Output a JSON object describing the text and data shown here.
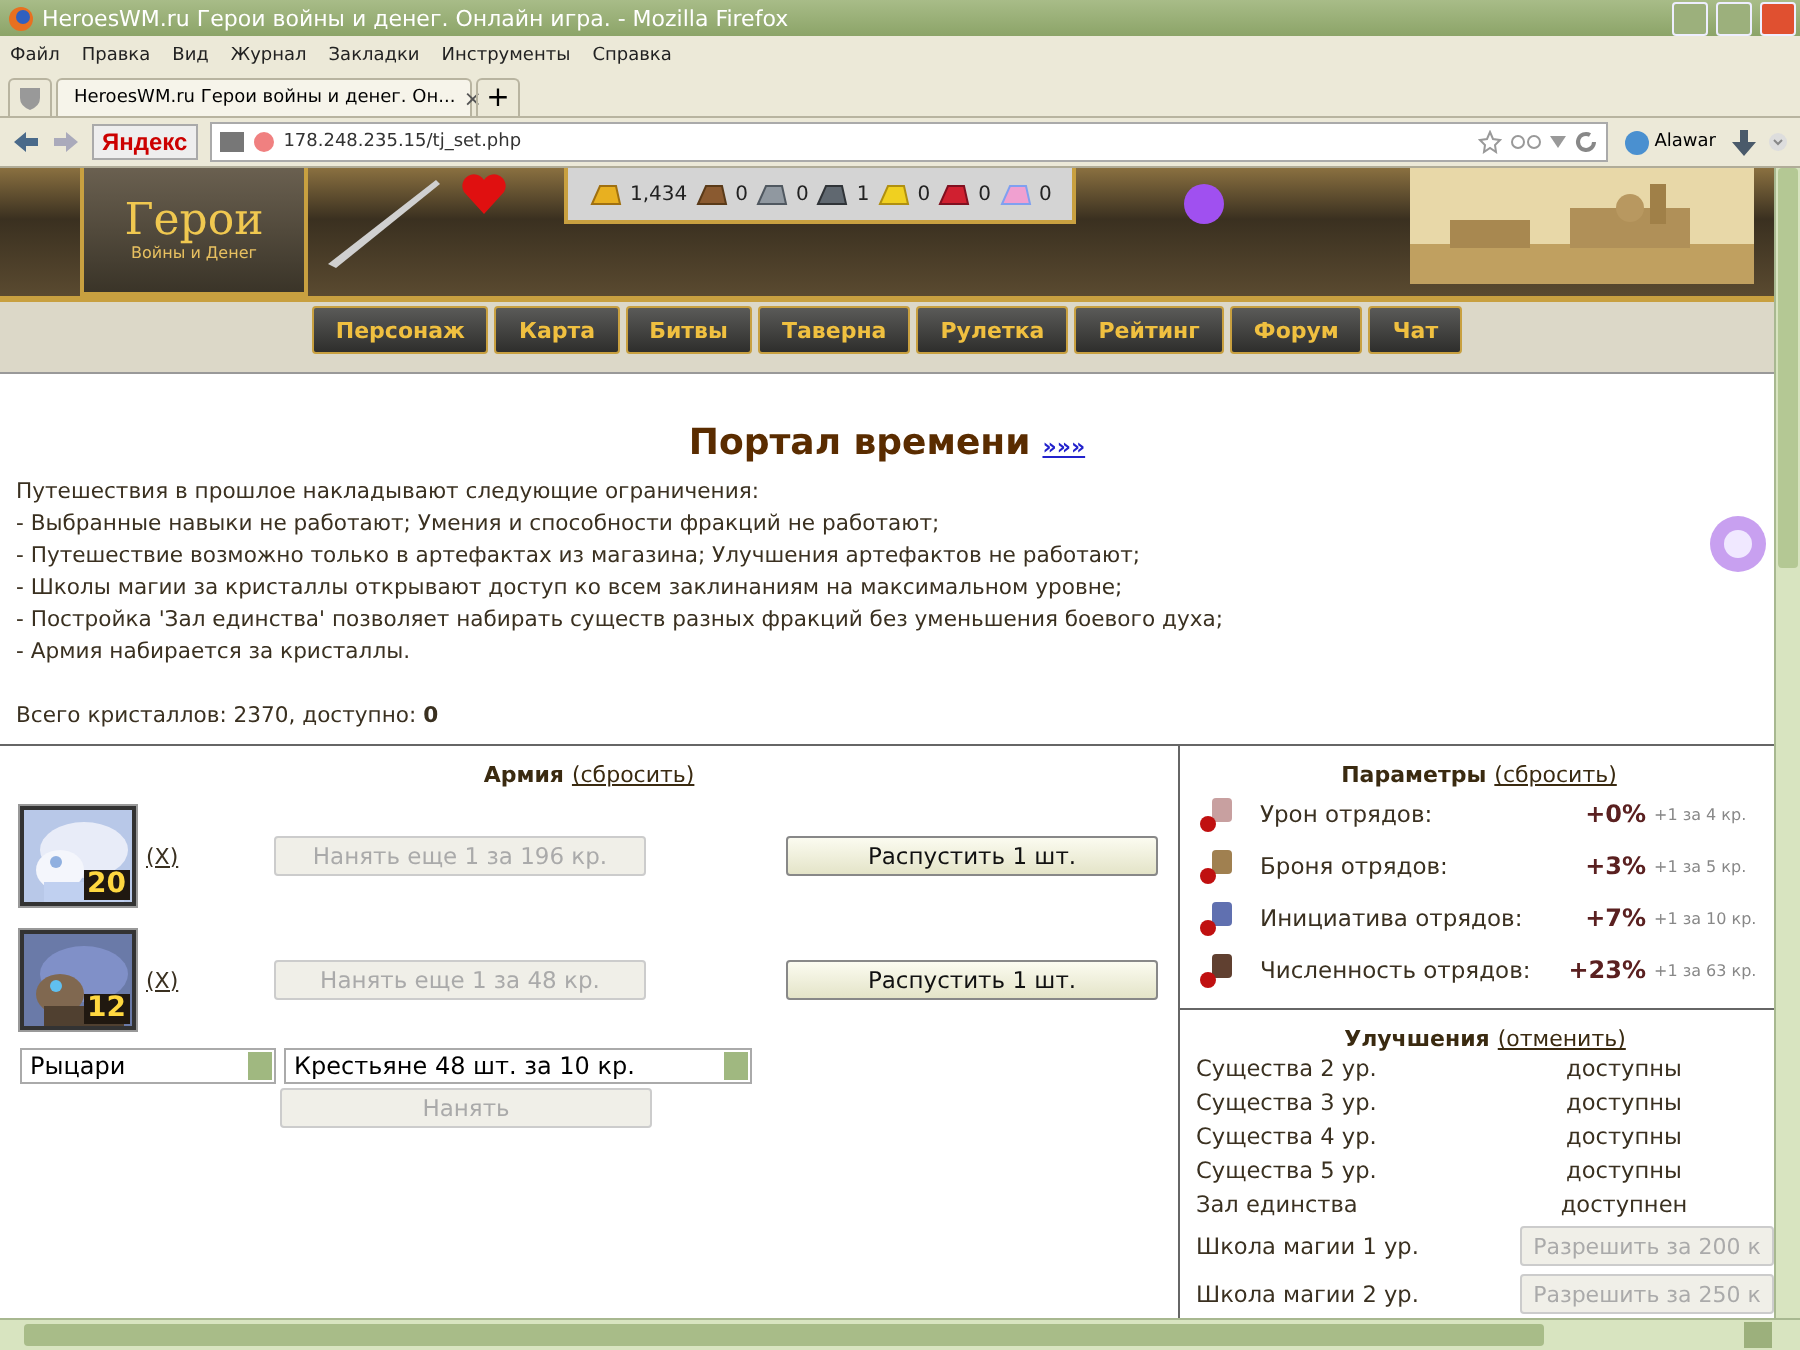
{
  "window": {
    "title": "HeroesWM.ru Герои войны и денег. Онлайн игра. - Mozilla Firefox"
  },
  "menu": [
    "Файл",
    "Правка",
    "Вид",
    "Журнал",
    "Закладки",
    "Инструменты",
    "Справка"
  ],
  "tabs": [
    {
      "label": "HeroesWM.ru Герои войны и денег. Он...",
      "close": "×",
      "selected": true
    }
  ],
  "new_tab": "+",
  "toolbar": {
    "search_brand": "Яндекс",
    "url": "178.248.235.15/tj_set.php",
    "addon": "Alawar"
  },
  "game_header": {
    "logo_title": "Герои",
    "logo_subtitle": "Войны и Денег",
    "resources": [
      {
        "amount": "1,434"
      },
      {
        "amount": "0"
      },
      {
        "amount": "0"
      },
      {
        "amount": "1"
      },
      {
        "amount": "0"
      },
      {
        "amount": "0"
      },
      {
        "amount": "0"
      }
    ],
    "nav": [
      "Персонаж",
      "Карта",
      "Битвы",
      "Таверна",
      "Рулетка",
      "Рейтинг",
      "Форум",
      "Чат"
    ]
  },
  "page": {
    "title": "Портал времени",
    "title_link": "»»»",
    "intro": [
      "Путешествия в прошлое накладывают следующие ограничения:",
      "- Выбранные навыки не работают; Умения и способности фракций не работают;",
      "- Путешествие возможно только в артефактах из магазина; Улучшения артефактов не работают;",
      "- Школы магии за кристаллы открывают доступ ко всем заклинаниям на максимальном уровне;",
      "- Постройка 'Зал единства' позволяет набирать существ разных фракций без уменьшения боевого духа;",
      "- Армия набирается за кристаллы."
    ],
    "crystals": "Всего кристаллов: 2370, доступно: **0**"
  },
  "army": {
    "title": "Армия",
    "reset": "(сбросить)",
    "units": [
      {
        "count": "20",
        "remove": "(X)",
        "hire": {
          "label": "Нанять еще 1 за 196 кр.",
          "disabled": true
        },
        "dismiss": "Распустить 1 шт."
      },
      {
        "count": "12",
        "remove": "(X)",
        "hire": {
          "label": "Нанять еще 1 за 48 кр.",
          "disabled": true
        },
        "dismiss": "Распустить 1 шт."
      }
    ],
    "faction_select": "Рыцари",
    "unit_select": "Крестьяне 48 шт. за 10 кр.",
    "hire_button": {
      "label": "Нанять",
      "disabled": true
    }
  },
  "parameters": {
    "title": "Параметры",
    "reset": "(сбросить)",
    "rows": [
      {
        "label": "Урон отрядов:",
        "value": "+0%",
        "cost": "+1 за 4 кр."
      },
      {
        "label": "Броня отрядов:",
        "value": "+3%",
        "cost": "+1 за 5 кр."
      },
      {
        "label": "Инициатива отрядов:",
        "value": "+7%",
        "cost": "+1 за 10 кр."
      },
      {
        "label": "Численность отрядов:",
        "value": "+23%",
        "cost": "+1 за 63 кр."
      }
    ]
  },
  "upgrades": {
    "title": "Улучшения",
    "cancel": "(отменить)",
    "rows": [
      {
        "kind": "status",
        "label": "Существа 2 ур.",
        "status": "доступны"
      },
      {
        "kind": "status",
        "label": "Существа 3 ур.",
        "status": "доступны"
      },
      {
        "kind": "status",
        "label": "Существа 4 ур.",
        "status": "доступны"
      },
      {
        "kind": "status",
        "label": "Существа 5 ур.",
        "status": "доступны"
      },
      {
        "kind": "status",
        "label": "Зал единства",
        "status": "доступнен"
      },
      {
        "kind": "button",
        "label": "Школа магии 1 ур.",
        "button": "Разрешить за 200 к",
        "disabled": true
      },
      {
        "kind": "button",
        "label": "Школа магии 2 ур.",
        "button": "Разрешить за 250 к",
        "disabled": true
      }
    ]
  }
}
